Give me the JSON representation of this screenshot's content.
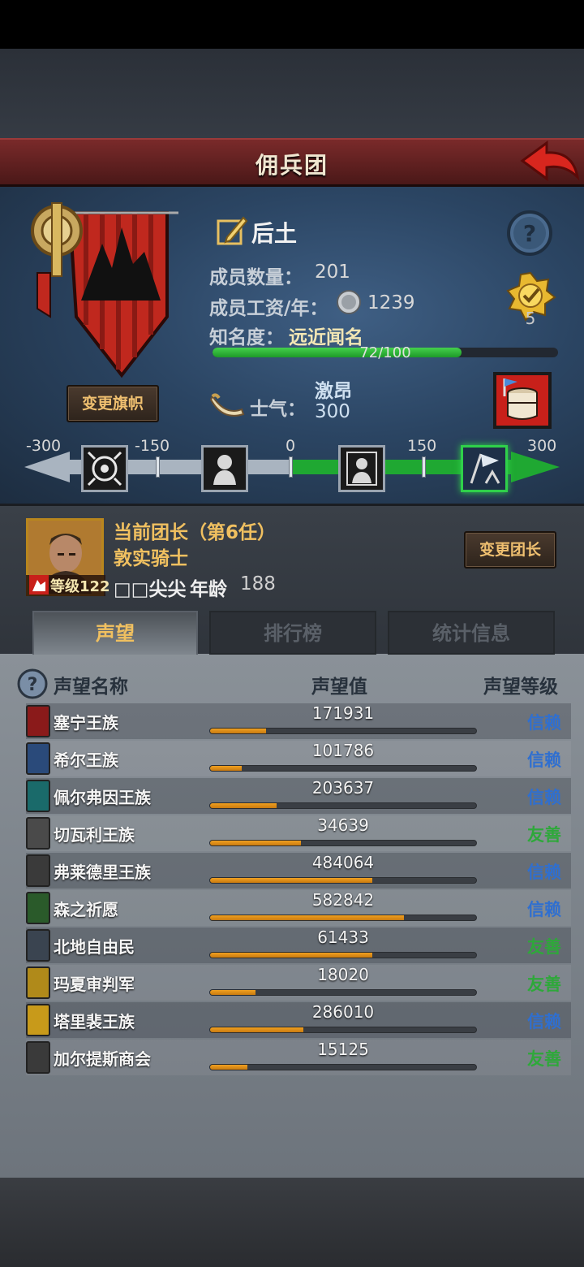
{
  "header": {
    "title": "佣兵团"
  },
  "guild": {
    "name": "后土",
    "members_label": "成员数量：",
    "members_value": "201",
    "wage_label": "成员工资/年：",
    "wage_value": "1239",
    "fame_label": "知名度：",
    "fame_value": "远近闻名",
    "fame_progress_text": "72/100",
    "fame_progress": 0.72,
    "rank_number": "5",
    "change_flag_label": "变更旗帜"
  },
  "morale": {
    "label": "士气：",
    "state": "激昂",
    "value": "300",
    "scale_ticks": [
      "-300",
      "-150",
      "0",
      "150",
      "300"
    ],
    "level_fraction": 1.0
  },
  "leader": {
    "title": "当前团长（第6任）",
    "class": "敦实骑士",
    "name": "□□尖尖",
    "age_label": "年龄",
    "age": "188",
    "level": "等级122",
    "change_label": "变更团长"
  },
  "tabs": [
    {
      "label": "声望",
      "active": true
    },
    {
      "label": "排行榜",
      "active": false
    },
    {
      "label": "统计信息",
      "active": false
    }
  ],
  "reputation": {
    "headers": {
      "name": "声望名称",
      "value": "声望值",
      "level": "声望等级"
    },
    "level_colors": {
      "信赖": "#2f6fd0",
      "友善": "#2ea83a"
    },
    "rows": [
      {
        "name": "塞宁王族",
        "value": "171931",
        "fill": 0.21,
        "level": "信赖",
        "icon": "red-banner-icon",
        "color": "#8a1a1a"
      },
      {
        "name": "希尔王族",
        "value": "101786",
        "fill": 0.12,
        "level": "信赖",
        "icon": "blue-banner-icon",
        "color": "#2a4a7a"
      },
      {
        "name": "佩尔弗因王族",
        "value": "203637",
        "fill": 0.25,
        "level": "信赖",
        "icon": "teal-banner-icon",
        "color": "#1a6a6a"
      },
      {
        "name": "切瓦利王族",
        "value": "34639",
        "fill": 0.34,
        "level": "友善",
        "icon": "scales-banner-icon",
        "color": "#4a4a4a"
      },
      {
        "name": "弗莱德里王族",
        "value": "484064",
        "fill": 0.61,
        "level": "信赖",
        "icon": "wolf-banner-icon",
        "color": "#3a3a3a"
      },
      {
        "name": "森之祈愿",
        "value": "582842",
        "fill": 0.73,
        "level": "信赖",
        "icon": "tree-banner-icon",
        "color": "#2a5a2a"
      },
      {
        "name": "北地自由民",
        "value": "61433",
        "fill": 0.61,
        "level": "友善",
        "icon": "axe-banner-icon",
        "color": "#3a4450"
      },
      {
        "name": "玛夏审判军",
        "value": "18020",
        "fill": 0.17,
        "level": "友善",
        "icon": "gold-banner-icon",
        "color": "#b08a1a"
      },
      {
        "name": "塔里裴王族",
        "value": "286010",
        "fill": 0.35,
        "level": "信赖",
        "icon": "crown-banner-icon",
        "color": "#c89a1a"
      },
      {
        "name": "加尔提斯商会",
        "value": "15125",
        "fill": 0.14,
        "level": "友善",
        "icon": "chest-banner-icon",
        "color": "#3a3a3a"
      }
    ]
  }
}
